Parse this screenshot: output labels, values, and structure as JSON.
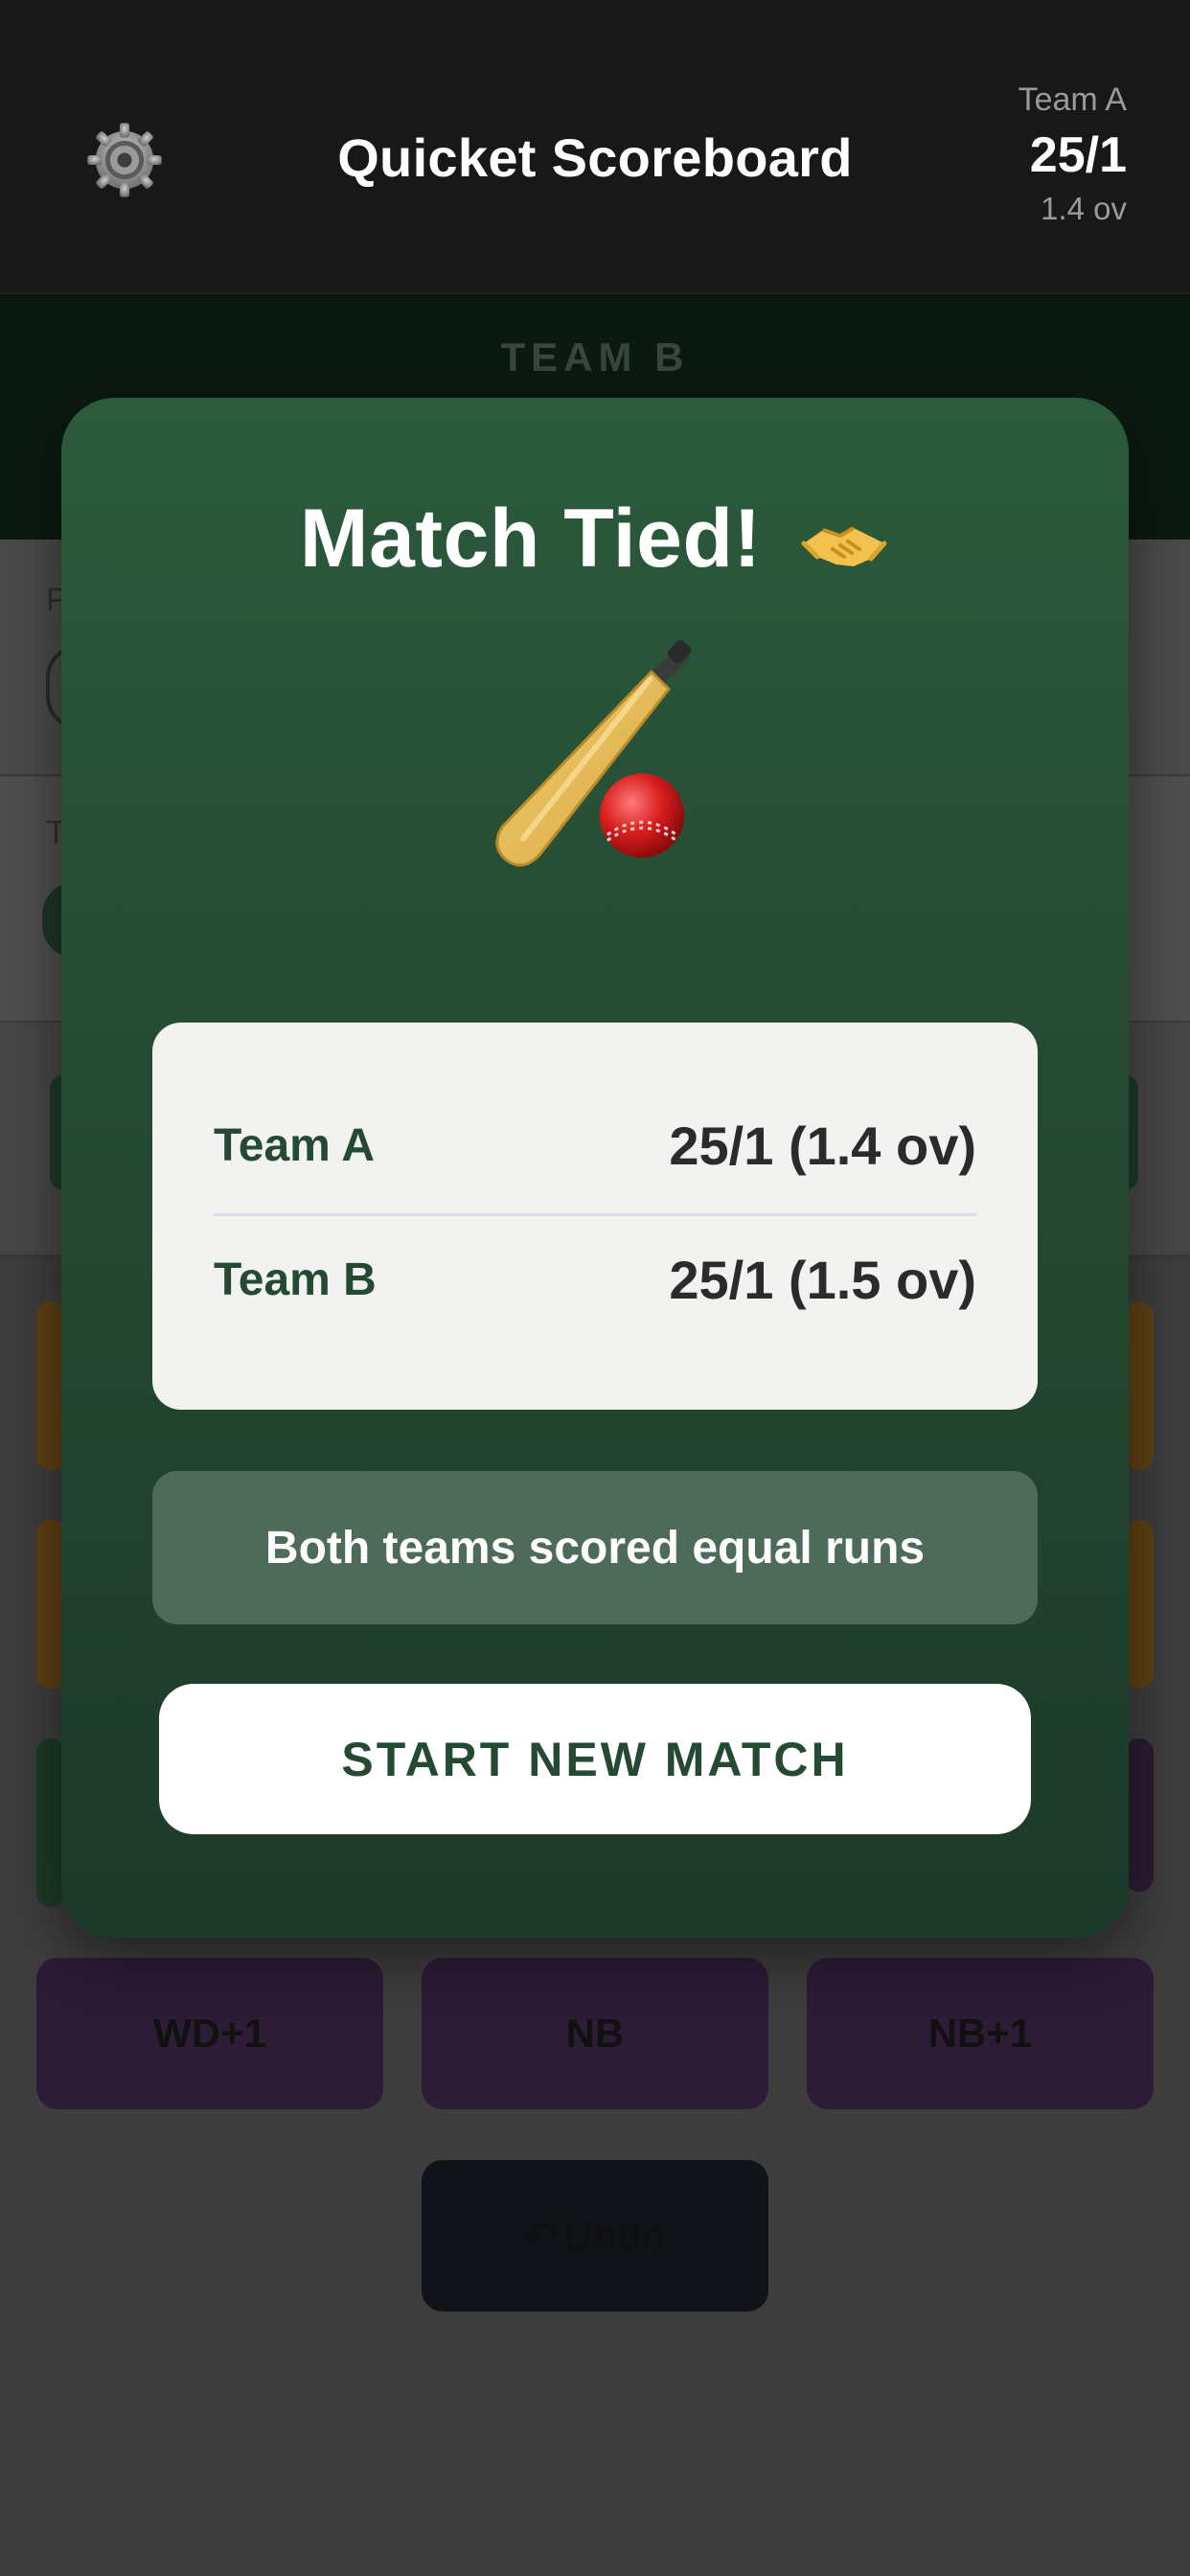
{
  "app": {
    "title": "Quicket Scoreboard"
  },
  "header": {
    "score_team": "Team A",
    "score_runs": "25/1",
    "score_overs": "1.4 ov"
  },
  "background": {
    "batting_label": "TEAM B",
    "extras": [
      {
        "label": "WD+1"
      },
      {
        "label": "NB"
      },
      {
        "label": "NB+1"
      }
    ],
    "undo_label": "Undo"
  },
  "modal": {
    "title": "Match Tied!",
    "title_emoji": "handshake-icon",
    "illustration": "cricket-bat-and-ball-icon",
    "scores": [
      {
        "team": "Team A",
        "score": "25/1 (1.4 ov)"
      },
      {
        "team": "Team B",
        "score": "25/1 (1.5 ov)"
      }
    ],
    "result_text": "Both teams scored equal runs",
    "new_match_label": "START NEW MATCH"
  },
  "colors": {
    "header_bg": "#181818",
    "modal_green": "#2b5a3c",
    "card_bg": "#f2f3f1",
    "team_text": "#254a33",
    "result_bg": "#4e6a59"
  }
}
